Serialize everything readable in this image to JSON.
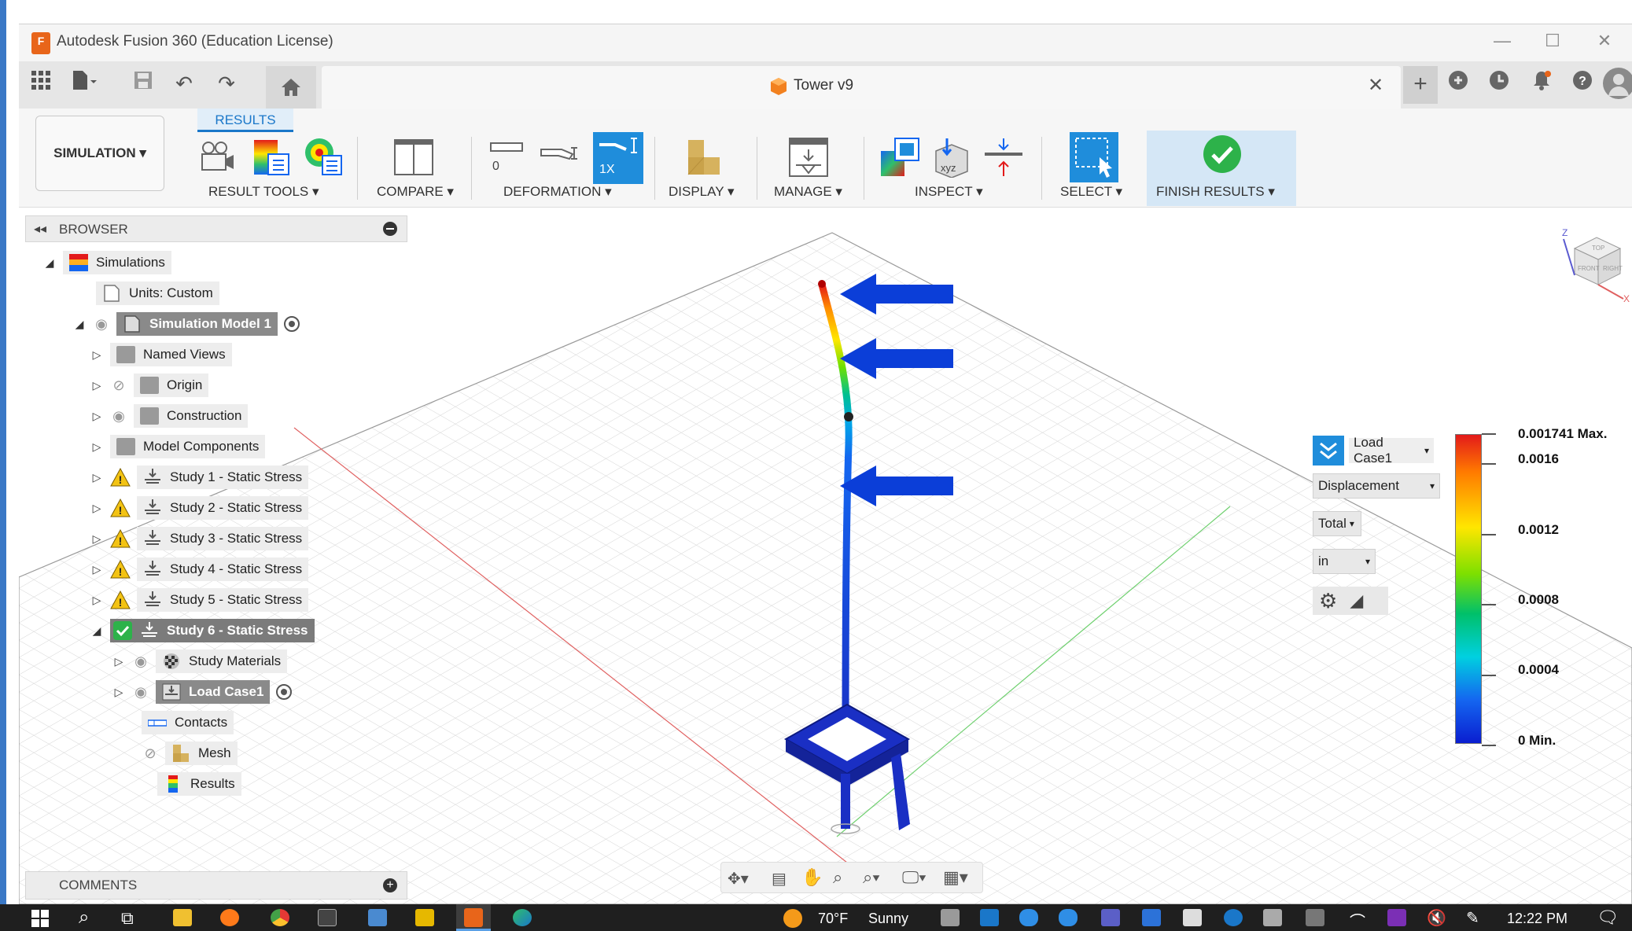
{
  "window": {
    "title": "Autodesk Fusion 360 (Education License)",
    "app_icon_text": "F"
  },
  "doc_tab": {
    "title": "Tower v9"
  },
  "ribbon": {
    "active_tab": "RESULTS",
    "workspace": "SIMULATION",
    "groups": {
      "result_tools": "RESULT TOOLS",
      "compare": "COMPARE",
      "deformation": "DEFORMATION",
      "display": "DISPLAY",
      "manage": "MANAGE",
      "inspect": "INSPECT",
      "select": "SELECT",
      "finish": "FINISH RESULTS"
    },
    "deformation_zero": "0",
    "deformation_scale": "1X",
    "inspect_xyz": "xyz"
  },
  "browser": {
    "title": "BROWSER",
    "items": [
      {
        "label": "Simulations"
      },
      {
        "label": "Units: Custom"
      },
      {
        "label": "Simulation Model 1"
      },
      {
        "label": "Named Views"
      },
      {
        "label": "Origin"
      },
      {
        "label": "Construction"
      },
      {
        "label": "Model Components"
      },
      {
        "label": "Study 1 - Static Stress"
      },
      {
        "label": "Study 2 - Static Stress"
      },
      {
        "label": "Study 3 - Static Stress"
      },
      {
        "label": "Study 4 - Static Stress"
      },
      {
        "label": "Study 5 - Static Stress"
      },
      {
        "label": "Study 6 - Static Stress"
      },
      {
        "label": "Study Materials"
      },
      {
        "label": "Load Case1"
      },
      {
        "label": "Contacts"
      },
      {
        "label": "Mesh"
      },
      {
        "label": "Results"
      }
    ]
  },
  "comments": {
    "title": "COMMENTS"
  },
  "results_panel": {
    "load_case": "Load Case1",
    "result_type": "Displacement",
    "component": "Total",
    "unit": "in"
  },
  "legend": {
    "max_label": "0.001741 Max.",
    "min_label": "0 Min.",
    "ticks": [
      "0.0016",
      "0.0012",
      "0.0008",
      "0.0004"
    ]
  },
  "viewcube": {
    "top": "TOP",
    "front": "FRONT",
    "right": "RIGHT",
    "z": "Z",
    "x": "X"
  },
  "taskbar": {
    "weather_temp": "70°F",
    "weather_desc": "Sunny",
    "time": "12:22 PM"
  },
  "colors": {
    "accent": "#1a77c9",
    "finish_bg": "#d5e7f6",
    "model_blue": "#1a2fc4",
    "arrow_blue": "#0b3ed8",
    "ok_green": "#2db24a",
    "warn_yellow": "#f3c313"
  }
}
